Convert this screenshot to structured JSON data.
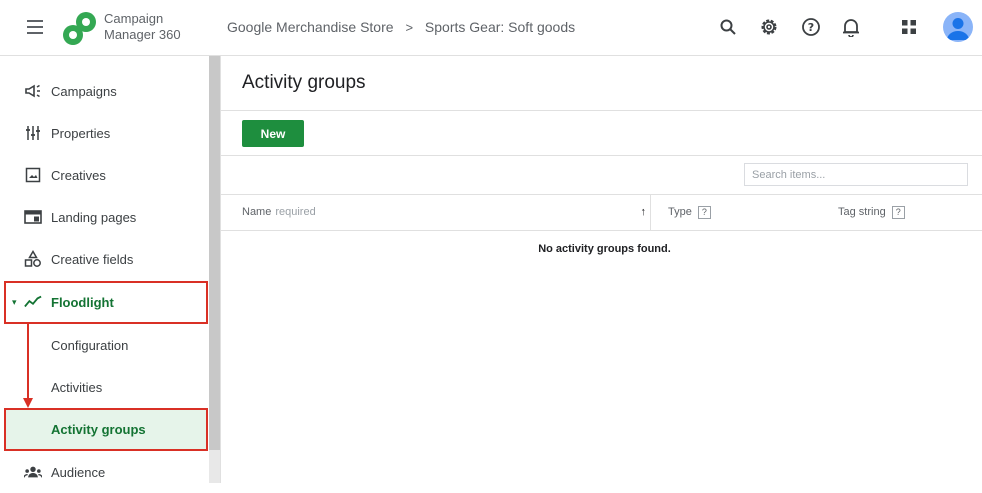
{
  "app": {
    "product_line1": "Campaign",
    "product_line2": "Manager 360",
    "accent": "#137333"
  },
  "breadcrumb": {
    "advertiser": "Google Merchandise Store",
    "separator": ">",
    "campaign": "Sports Gear: Soft goods"
  },
  "top_icons": [
    "search-icon",
    "gear-icon",
    "help-icon",
    "bell-icon",
    "apps-grid-icon",
    "avatar"
  ],
  "sidebar": {
    "items": [
      {
        "label": "Campaigns",
        "icon": "megaphone-icon"
      },
      {
        "label": "Properties",
        "icon": "sliders-icon"
      },
      {
        "label": "Creatives",
        "icon": "image-icon"
      },
      {
        "label": "Landing pages",
        "icon": "landing-page-icon"
      },
      {
        "label": "Creative fields",
        "icon": "shapes-icon"
      },
      {
        "label": "Floodlight",
        "icon": "floodlight-icon",
        "expanded": true
      },
      {
        "label": "Configuration"
      },
      {
        "label": "Activities"
      },
      {
        "label": "Activity groups",
        "active": true
      },
      {
        "label": "Audience",
        "icon": "audience-icon"
      }
    ]
  },
  "main": {
    "title": "Activity groups",
    "new_label": "New",
    "search_placeholder": "Search items...",
    "columns": {
      "name": "Name",
      "name_hint": "required",
      "sort_glyph": "↑",
      "type": "Type",
      "tag_string": "Tag string",
      "help_glyph": "?"
    },
    "empty_message": "No activity groups found."
  },
  "colors": {
    "new_button": "#1e8e3e",
    "highlight_border": "#d93025",
    "active_bg": "#e6f4ea"
  }
}
